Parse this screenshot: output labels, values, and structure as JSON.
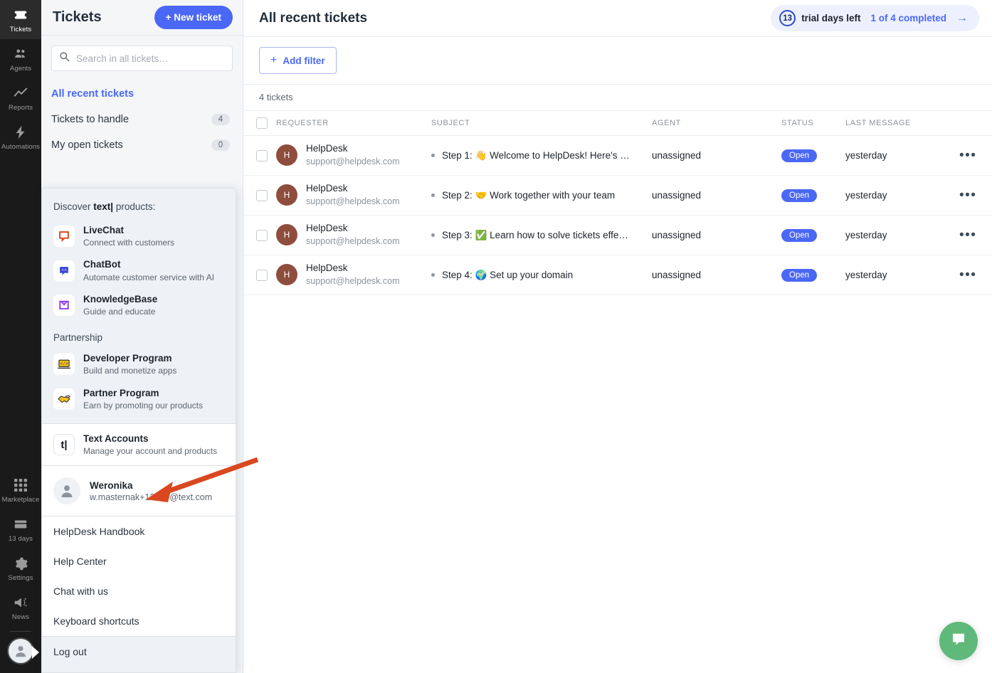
{
  "rail": {
    "items": [
      {
        "label": "Tickets",
        "icon": "ticket-icon",
        "active": true
      },
      {
        "label": "Agents",
        "icon": "agents-icon",
        "active": false
      },
      {
        "label": "Reports",
        "icon": "reports-icon",
        "active": false
      },
      {
        "label": "Automations",
        "icon": "automations-icon",
        "active": false
      }
    ],
    "bottom_items": [
      {
        "label": "Marketplace",
        "icon": "marketplace-icon"
      },
      {
        "label": "13 days",
        "icon": "subscription-icon"
      },
      {
        "label": "Settings",
        "icon": "gear-icon"
      },
      {
        "label": "News",
        "icon": "megaphone-icon"
      }
    ]
  },
  "tickets_panel": {
    "title": "Tickets",
    "new_ticket_label": "+ New ticket",
    "search_placeholder": "Search in all tickets…",
    "search_value": "",
    "nav": [
      {
        "label": "All recent tickets",
        "badge": "",
        "active": true
      },
      {
        "label": "Tickets to handle",
        "badge": "4",
        "active": false
      },
      {
        "label": "My open tickets",
        "badge": "0",
        "active": false
      }
    ]
  },
  "dropdown": {
    "discover_prefix": "Discover ",
    "discover_brand": "text|",
    "discover_suffix": " products:",
    "products": [
      {
        "name": "LiveChat",
        "desc": "Connect with customers",
        "icon": "livechat-icon"
      },
      {
        "name": "ChatBot",
        "desc": "Automate customer service with AI",
        "icon": "chatbot-icon"
      },
      {
        "name": "KnowledgeBase",
        "desc": "Guide and educate",
        "icon": "knowledgebase-icon"
      }
    ],
    "partnership_label": "Partnership",
    "partnership": [
      {
        "name": "Developer Program",
        "desc": "Build and monetize apps",
        "icon": "developer-program-icon"
      },
      {
        "name": "Partner Program",
        "desc": "Earn by promoting our products",
        "icon": "partner-program-icon"
      }
    ],
    "accounts": {
      "name": "Text Accounts",
      "desc": "Manage your account and products",
      "icon": "text-accounts-icon"
    },
    "user": {
      "name": "Weronika",
      "email": "w.masternak+12345@text.com"
    },
    "links": [
      "HelpDesk Handbook",
      "Help Center",
      "Chat with us",
      "Keyboard shortcuts"
    ],
    "logout_label": "Log out"
  },
  "main": {
    "title": "All recent tickets",
    "trial": {
      "days": "13",
      "days_label": "trial days left",
      "progress": "1 of 4 completed",
      "arrow": "→"
    },
    "add_filter_label": "Add filter",
    "add_filter_plus": "+",
    "count_label": "4 tickets",
    "columns": [
      "REQUESTER",
      "SUBJECT",
      "AGENT",
      "STATUS",
      "LAST MESSAGE"
    ],
    "rows": [
      {
        "requester_name": "HelpDesk",
        "requester_email": "support@helpdesk.com",
        "avatar_initial": "H",
        "subject": "Step 1: 👋 Welcome to HelpDesk! Here's …",
        "agent": "unassigned",
        "status": "Open",
        "last_message": "yesterday"
      },
      {
        "requester_name": "HelpDesk",
        "requester_email": "support@helpdesk.com",
        "avatar_initial": "H",
        "subject": "Step 2: 🤝 Work together with your team",
        "agent": "unassigned",
        "status": "Open",
        "last_message": "yesterday"
      },
      {
        "requester_name": "HelpDesk",
        "requester_email": "support@helpdesk.com",
        "avatar_initial": "H",
        "subject": "Step 3: ✅ Learn how to solve tickets effe…",
        "agent": "unassigned",
        "status": "Open",
        "last_message": "yesterday"
      },
      {
        "requester_name": "HelpDesk",
        "requester_email": "support@helpdesk.com",
        "avatar_initial": "H",
        "subject": "Step 4: 🌍 Set up your domain",
        "agent": "unassigned",
        "status": "Open",
        "last_message": "yesterday"
      }
    ],
    "more_glyph": "•••"
  },
  "colors": {
    "brand_blue": "#4a68f5",
    "rail_dark": "#1a1a1a",
    "panel_bg": "#f4f6f8",
    "dropdown_bg": "#eef1f5",
    "annotation_orange": "#d9481f",
    "chat_green": "#5fb97a",
    "avatar_brown": "#8f4d3d"
  }
}
